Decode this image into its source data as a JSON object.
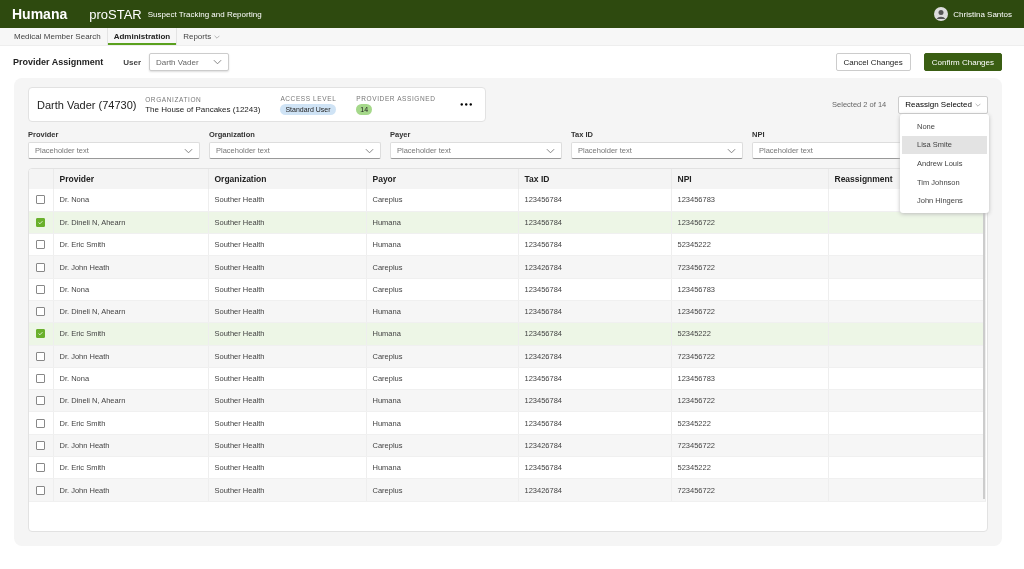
{
  "app_bar": {
    "logo": "Humana",
    "product": "proSTAR",
    "subtitle": "Suspect Tracking and Reporting",
    "user": "Christina Santos"
  },
  "nav": [
    {
      "label": "Medical Member Search",
      "selected": false,
      "kind": "link"
    },
    {
      "label": "Administration",
      "selected": true,
      "kind": "link"
    },
    {
      "label": "Reports",
      "selected": false,
      "kind": "menu"
    }
  ],
  "page": {
    "title": "Provider Assignment",
    "user_label": "User",
    "user_value": "Darth Vader",
    "cancel": "Cancel Changes",
    "confirm": "Confirm Changes"
  },
  "user_card": {
    "name": "Darth Vader (74730)",
    "org_label": "ORGANIZATION",
    "org": "The House of Pancakes (12243)",
    "access_label": "ACCESS LEVEL",
    "access": "Standard User",
    "assigned_label": "PROVIDER ASSIGNED",
    "assigned": "14",
    "more": "•••"
  },
  "selection": {
    "count": "Selected 2 of 14",
    "reassign": "Reassign Selected"
  },
  "reassign_menu": [
    {
      "label": "None",
      "selected": false
    },
    {
      "label": "Lisa Smite",
      "selected": true
    },
    {
      "label": "Andrew Louis",
      "selected": false
    },
    {
      "label": "Tim Johnson",
      "selected": false
    },
    {
      "label": "John Hingens",
      "selected": false
    }
  ],
  "filters": [
    {
      "label": "Provider",
      "placeholder": "Placeholder text"
    },
    {
      "label": "Organization",
      "placeholder": "Placeholder text"
    },
    {
      "label": "Payer",
      "placeholder": "Placeholder text"
    },
    {
      "label": "Tax ID",
      "placeholder": "Placeholder text"
    },
    {
      "label": "NPI",
      "placeholder": "Placeholder text"
    }
  ],
  "table": {
    "columns": [
      "Provider",
      "Organization",
      "Payor",
      "Tax ID",
      "NPI",
      "Reassignment"
    ],
    "rows": [
      {
        "checked": false,
        "cells": [
          "Dr. Nona",
          "Souther Health",
          "Careplus",
          "123456784",
          "123456783"
        ]
      },
      {
        "checked": true,
        "cells": [
          "Dr. Dineli N, Ahearn",
          "Souther Health",
          "Humana",
          "123456784",
          "123456722"
        ]
      },
      {
        "checked": false,
        "cells": [
          "Dr. Eric Smith",
          "Souther Health",
          "Humana",
          "123456784",
          "52345222"
        ]
      },
      {
        "checked": false,
        "cells": [
          "Dr. John Heath",
          "Souther Health",
          "Careplus",
          "123426784",
          "723456722"
        ]
      },
      {
        "checked": false,
        "cells": [
          "Dr. Nona",
          "Souther Health",
          "Careplus",
          "123456784",
          "123456783"
        ]
      },
      {
        "checked": false,
        "cells": [
          "Dr. Dineli N, Ahearn",
          "Souther Health",
          "Humana",
          "123456784",
          "123456722"
        ]
      },
      {
        "checked": true,
        "cells": [
          "Dr. Eric Smith",
          "Souther Health",
          "Humana",
          "123456784",
          "52345222"
        ]
      },
      {
        "checked": false,
        "cells": [
          "Dr. John Heath",
          "Souther Health",
          "Careplus",
          "123426784",
          "723456722"
        ]
      },
      {
        "checked": false,
        "cells": [
          "Dr. Nona",
          "Souther Health",
          "Careplus",
          "123456784",
          "123456783"
        ]
      },
      {
        "checked": false,
        "cells": [
          "Dr. Dineli N, Ahearn",
          "Souther Health",
          "Humana",
          "123456784",
          "123456722"
        ]
      },
      {
        "checked": false,
        "cells": [
          "Dr. Eric Smith",
          "Souther Health",
          "Humana",
          "123456784",
          "52345222"
        ]
      },
      {
        "checked": false,
        "cells": [
          "Dr. John Heath",
          "Souther Health",
          "Careplus",
          "123426784",
          "723456722"
        ]
      },
      {
        "checked": false,
        "cells": [
          "Dr. Eric Smith",
          "Souther Health",
          "Humana",
          "123456784",
          "52345222"
        ]
      },
      {
        "checked": false,
        "cells": [
          "Dr. John Heath",
          "Souther Health",
          "Careplus",
          "123426784",
          "723456722"
        ]
      }
    ]
  }
}
